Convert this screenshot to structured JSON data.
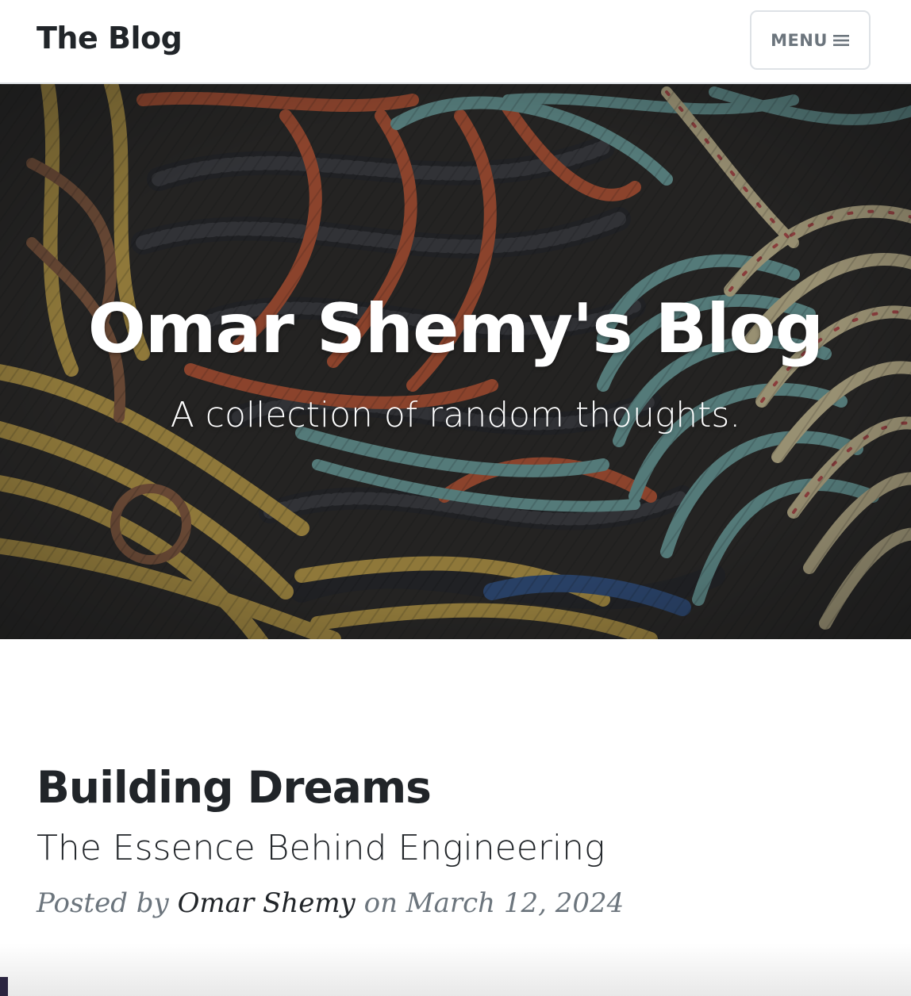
{
  "navbar": {
    "brand": "The Blog",
    "menu_label": "MENU",
    "menu_icon": "hamburger-icon"
  },
  "masthead": {
    "title": "Omar Shemy's Blog",
    "subtitle": "A collection of random thoughts.",
    "background": "rope-photo"
  },
  "post": {
    "title": "Building Dreams",
    "subtitle": "The Essence Behind Engineering",
    "meta_prefix": "Posted by",
    "author": "Omar Shemy",
    "meta_mid": "on",
    "date": "March 12, 2024"
  },
  "colors": {
    "text_dark": "#212529",
    "text_muted": "#6c757d",
    "border": "#dee2e6",
    "rope_orange": "#c4542f",
    "rope_teal": "#6fa8a5",
    "rope_yellow": "#c9a544",
    "rope_black": "#2b2b2b",
    "rope_cream": "#d8c99a"
  }
}
